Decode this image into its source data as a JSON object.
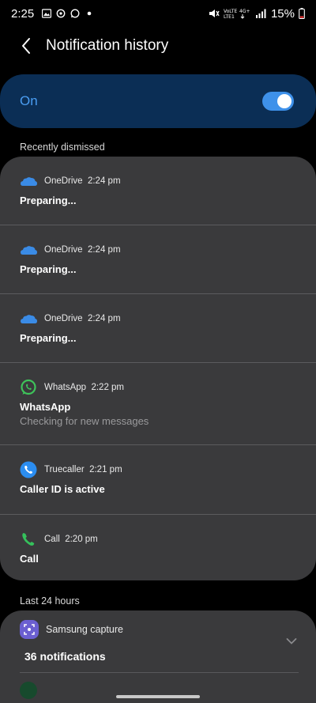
{
  "status_bar": {
    "time": "2:25",
    "battery": "15%",
    "network": "Vo)) 4G+ LTE1"
  },
  "header": {
    "title": "Notification history",
    "back_icon": "back-arrow-icon"
  },
  "master_toggle": {
    "label": "On",
    "state": "on",
    "accent_color": "#3e91ea"
  },
  "sections": {
    "recently_dismissed": "Recently dismissed",
    "last_24_hours": "Last 24 hours"
  },
  "notifications": [
    {
      "app": "OneDrive",
      "time": "2:24 pm",
      "title": "Preparing...",
      "text": "",
      "icon": "onedrive-cloud-icon"
    },
    {
      "app": "OneDrive",
      "time": "2:24 pm",
      "title": "Preparing...",
      "text": "",
      "icon": "onedrive-cloud-icon"
    },
    {
      "app": "OneDrive",
      "time": "2:24 pm",
      "title": "Preparing...",
      "text": "",
      "icon": "onedrive-cloud-icon"
    },
    {
      "app": "WhatsApp",
      "time": "2:22 pm",
      "title": "WhatsApp",
      "text": "Checking for new messages",
      "icon": "whatsapp-icon"
    },
    {
      "app": "Truecaller",
      "time": "2:21 pm",
      "title": "Caller ID is active",
      "text": "",
      "icon": "truecaller-phone-icon"
    },
    {
      "app": "Call",
      "time": "2:20 pm",
      "title": "Call",
      "text": "",
      "icon": "phone-call-icon"
    }
  ],
  "last24": [
    {
      "app": "Samsung capture",
      "count_label": "36 notifications",
      "icon": "samsung-capture-icon"
    }
  ]
}
